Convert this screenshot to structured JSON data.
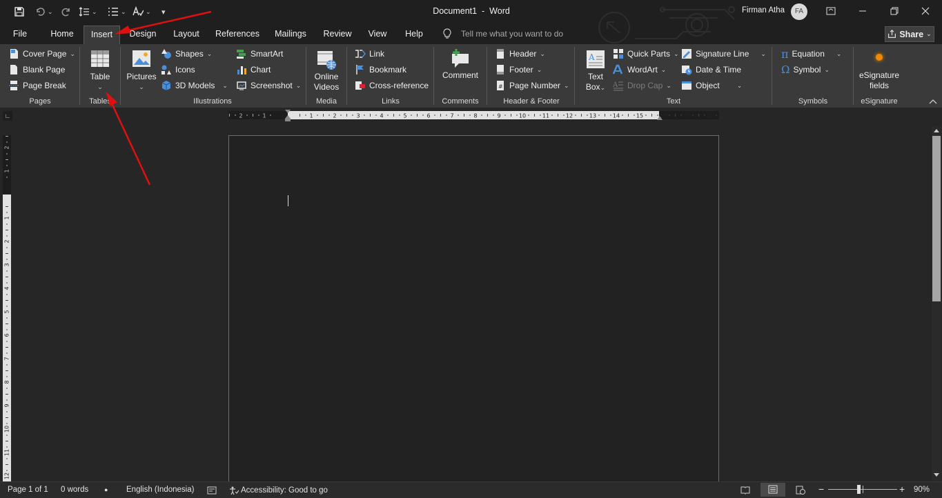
{
  "window": {
    "title": "Document1  -  Word",
    "user_name": "Firman Atha",
    "user_initials": "FA"
  },
  "quick_access": {
    "save": "save-icon",
    "undo": "undo-icon",
    "redo": "redo-icon",
    "customize": "▾"
  },
  "tabs": [
    "File",
    "Home",
    "Insert",
    "Design",
    "Layout",
    "References",
    "Mailings",
    "Review",
    "View",
    "Help"
  ],
  "active_tab": "Insert",
  "tell_me": {
    "placeholder": "Tell me what you want to do"
  },
  "share_label": "Share",
  "ribbon": {
    "pages": {
      "label": "Pages",
      "cover_page": "Cover Page",
      "blank_page": "Blank Page",
      "page_break": "Page Break"
    },
    "tables": {
      "label": "Tables",
      "table": "Table"
    },
    "illustrations": {
      "label": "Illustrations",
      "pictures": "Pictures",
      "shapes": "Shapes",
      "icons": "Icons",
      "models_3d": "3D Models",
      "smartart": "SmartArt",
      "chart": "Chart",
      "screenshot": "Screenshot"
    },
    "media": {
      "label": "Media",
      "online_videos_1": "Online",
      "online_videos_2": "Videos"
    },
    "links": {
      "label": "Links",
      "link": "Link",
      "bookmark": "Bookmark",
      "cross_reference": "Cross-reference"
    },
    "comments": {
      "label": "Comments",
      "comment": "Comment"
    },
    "header_footer": {
      "label": "Header & Footer",
      "header": "Header",
      "footer": "Footer",
      "page_number": "Page Number"
    },
    "text": {
      "label": "Text",
      "text_box_1": "Text",
      "text_box_2": "Box",
      "quick_parts": "Quick Parts",
      "wordart": "WordArt",
      "drop_cap": "Drop Cap",
      "signature_line": "Signature Line",
      "date_time": "Date & Time",
      "object": "Object"
    },
    "symbols": {
      "label": "Symbols",
      "equation": "Equation",
      "symbol": "Symbol"
    },
    "esignature": {
      "label": "eSignature",
      "fields_1": "eSignature",
      "fields_2": "fields"
    }
  },
  "ruler": {
    "horizontal_ticks": [
      "2",
      "1",
      "1",
      "2",
      "3",
      "4",
      "5",
      "6",
      "7",
      "8",
      "9",
      "10",
      "11",
      "12",
      "13",
      "14",
      "15",
      "16",
      "17",
      "18"
    ],
    "vertical_ticks": [
      "2",
      "1",
      "1",
      "2",
      "3",
      "4",
      "5",
      "6",
      "7",
      "8",
      "9",
      "10",
      "11",
      "12"
    ]
  },
  "status": {
    "page": "Page 1 of 1",
    "words": "0 words",
    "language": "English (Indonesia)",
    "accessibility": "Accessibility: Good to go",
    "zoom_minus": "−",
    "zoom_plus": "+",
    "zoom_level": "90%"
  },
  "colors": {
    "annotation_arrow": "#e01010",
    "esignature_dot": "#f08a00",
    "accent_blue": "#4a8fd8"
  }
}
